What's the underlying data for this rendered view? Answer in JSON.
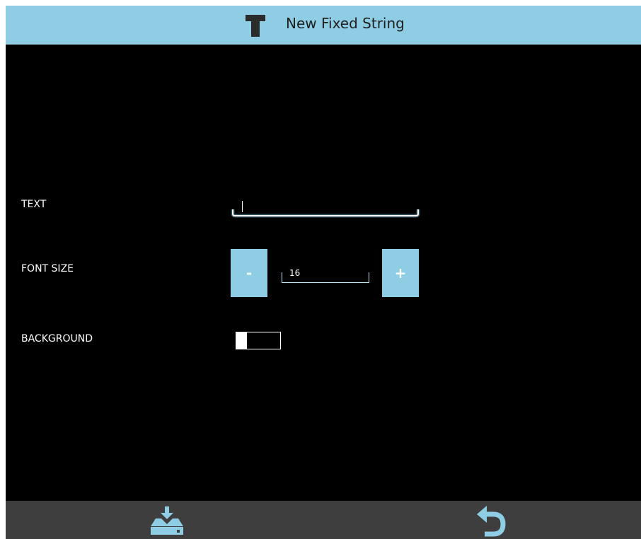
{
  "header": {
    "title": "New Fixed String",
    "icon": "text-format-icon",
    "background_color": "#8ecde4"
  },
  "form": {
    "text": {
      "label": "TEXT",
      "value": ""
    },
    "font_size": {
      "label": "FONT SIZE",
      "value": "16",
      "decrement_label": "-",
      "increment_label": "+"
    },
    "background": {
      "label": "BACKGROUND",
      "checked": false
    }
  },
  "footer": {
    "save_icon": "save-to-drive-icon",
    "undo_icon": "undo-icon",
    "icon_color": "#8ecde4",
    "background_color": "#3e3e3e"
  }
}
